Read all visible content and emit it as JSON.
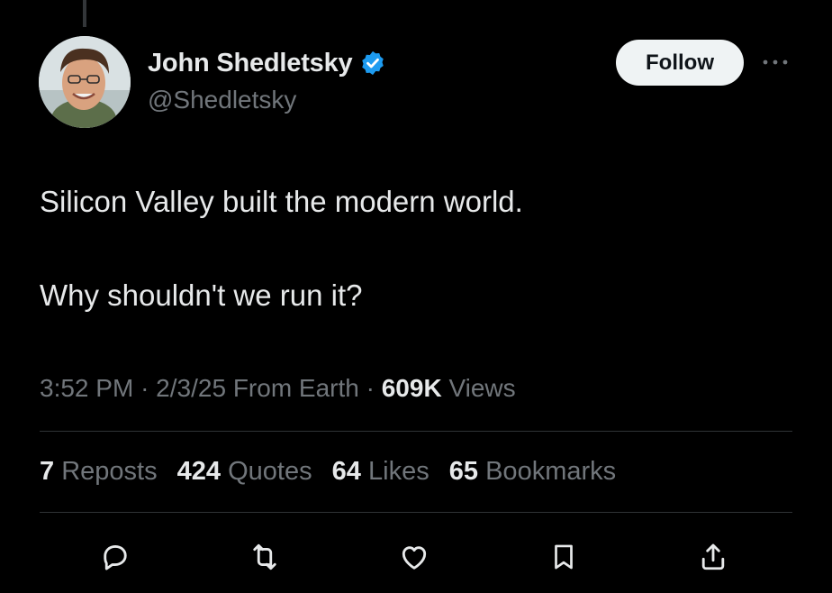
{
  "author": {
    "display_name": "John Shedletsky",
    "handle": "@Shedletsky",
    "verified": true,
    "verified_color": "#1d9bf0"
  },
  "follow_label": "Follow",
  "more_icon": "more-horizontal-icon",
  "tweet": {
    "line1": "Silicon Valley built the modern world.",
    "line2": "Why shouldn't we run it?"
  },
  "meta": {
    "time": "3:52 PM",
    "date": "2/3/25",
    "source": "From Earth",
    "views_count": "609K",
    "views_label": "Views"
  },
  "stats": {
    "reposts_count": "7",
    "reposts_label": "Reposts",
    "quotes_count": "424",
    "quotes_label": "Quotes",
    "likes_count": "64",
    "likes_label": "Likes",
    "bookmarks_count": "65",
    "bookmarks_label": "Bookmarks"
  },
  "actions": [
    "reply-icon",
    "repost-icon",
    "like-icon",
    "bookmark-icon",
    "share-icon"
  ],
  "colors": {
    "background": "#000000",
    "primary_text": "#e7e9ea",
    "secondary_text": "#71767b",
    "divider": "#2f3336",
    "follow_bg": "#eff3f4"
  }
}
